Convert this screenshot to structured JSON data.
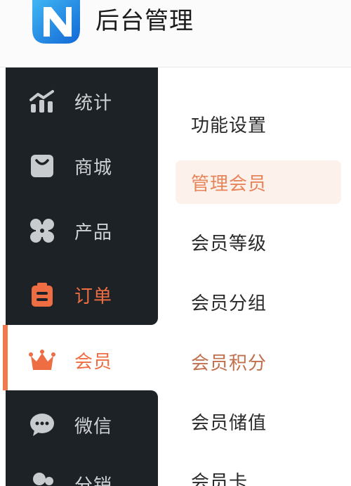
{
  "header": {
    "title": "后台管理",
    "logo_icon": "n-logo-icon"
  },
  "sidebar": {
    "items": [
      {
        "label": "统计",
        "icon": "stats-icon",
        "state": "normal"
      },
      {
        "label": "商城",
        "icon": "shopping-bag-icon",
        "state": "normal"
      },
      {
        "label": "产品",
        "icon": "grid-icon",
        "state": "normal"
      },
      {
        "label": "订单",
        "icon": "clipboard-icon",
        "state": "highlight"
      },
      {
        "label": "会员",
        "icon": "crown-icon",
        "state": "active"
      },
      {
        "label": "微信",
        "icon": "chat-icon",
        "state": "normal"
      },
      {
        "label": "分销",
        "icon": "people-icon",
        "state": "normal"
      }
    ]
  },
  "submenu": {
    "items": [
      {
        "label": "功能设置"
      },
      {
        "label": "管理会员",
        "state": "active"
      },
      {
        "label": "会员等级"
      },
      {
        "label": "会员分组"
      },
      {
        "label": "会员积分",
        "state": "accent"
      },
      {
        "label": "会员储值"
      },
      {
        "label": "会员卡"
      }
    ]
  },
  "colors": {
    "accent": "#ef6d42",
    "sidebar_bg": "#1d2226",
    "submenu_active_bg": "#fdf1ec"
  }
}
